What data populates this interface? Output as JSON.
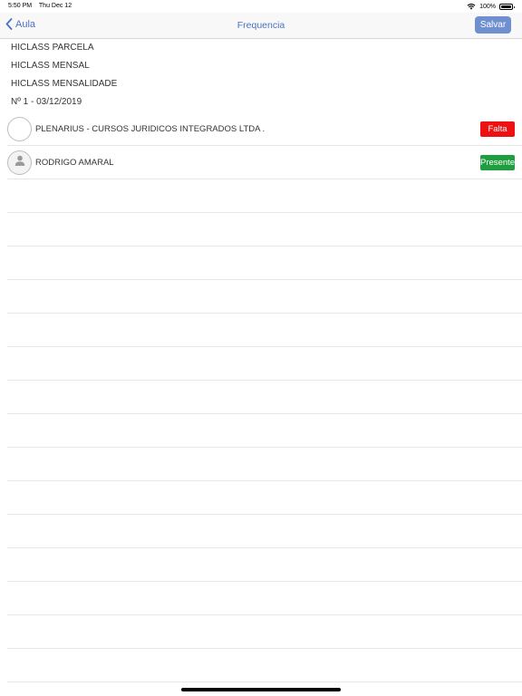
{
  "status_bar": {
    "time": "5:50 PM",
    "date": "Thu Dec 12",
    "battery": "100%",
    "battery_level": 1.0
  },
  "nav": {
    "back_label": "Aula",
    "title": "Frequencia",
    "save_label": "Salvar"
  },
  "info": {
    "line1": "HICLASS PARCELA",
    "line2": "HICLASS MENSAL",
    "line3": "HICLASS MENSALIDADE",
    "line4": "Nº 1 - 03/12/2019"
  },
  "attendance": [
    {
      "name": "PLENARIUS - CURSOS JURIDICOS INTEGRADOS LTDA .",
      "status": "Falta",
      "status_color": "#ee1111",
      "avatar": "empty"
    },
    {
      "name": "RODRIGO AMARAL",
      "status": "Presente",
      "status_color": "#1e9e3e",
      "avatar": "person-icon"
    }
  ],
  "colors": {
    "accent": "#4a72c8",
    "save_button": "#6f8fd1"
  }
}
